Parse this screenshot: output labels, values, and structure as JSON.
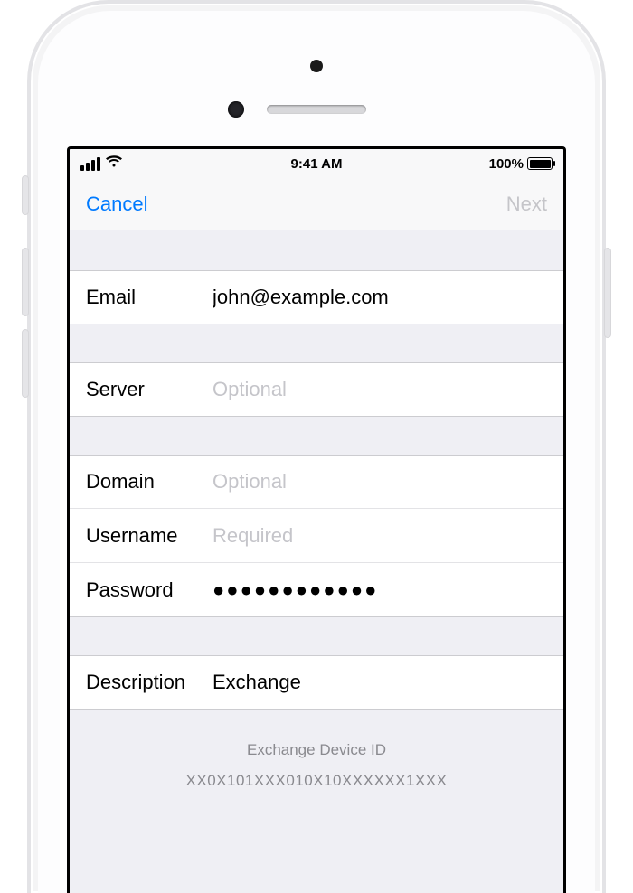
{
  "status": {
    "time": "9:41 AM",
    "battery_pct": "100%"
  },
  "nav": {
    "cancel": "Cancel",
    "next": "Next"
  },
  "fields": {
    "email": {
      "label": "Email",
      "value": "john@example.com",
      "placeholder": ""
    },
    "server": {
      "label": "Server",
      "value": "",
      "placeholder": "Optional"
    },
    "domain": {
      "label": "Domain",
      "value": "",
      "placeholder": "Optional"
    },
    "username": {
      "label": "Username",
      "value": "",
      "placeholder": "Required"
    },
    "password": {
      "label": "Password",
      "value": "●●●●●●●●●●●●"
    },
    "description": {
      "label": "Description",
      "value": "Exchange",
      "placeholder": ""
    }
  },
  "footer": {
    "title": "Exchange Device ID",
    "device_id": "XX0X101XXX010X10XXXXXX1XXX"
  }
}
